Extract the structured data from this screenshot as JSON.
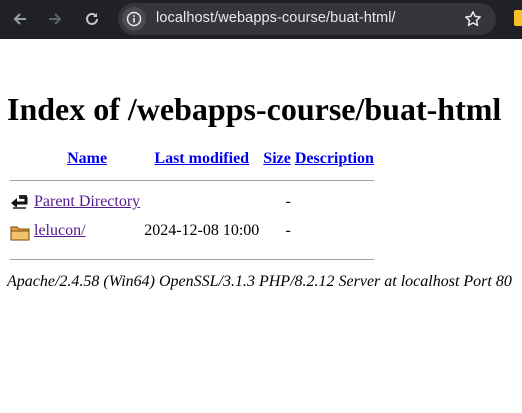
{
  "browser": {
    "url": "localhost/webapps-course/buat-html/",
    "icons": {
      "back": "arrow-left-icon",
      "forward": "arrow-right-icon",
      "reload": "reload-icon",
      "site_info": "site-info-icon",
      "bookmark": "star-icon"
    },
    "colors": {
      "toolbar": "#202124",
      "omnibox": "#35363a",
      "url_text": "#e8eaed"
    }
  },
  "page": {
    "title": "Index of /webapps-course/buat-html",
    "columns": {
      "name": "Name",
      "last_modified": "Last modified",
      "size": "Size",
      "description": "Description"
    },
    "rows": [
      {
        "icon": "back-folder-icon",
        "name": "Parent Directory",
        "last_modified": "",
        "size": "-",
        "description": ""
      },
      {
        "icon": "folder-icon",
        "name": "lelucon/",
        "last_modified": "2024-12-08 10:00",
        "size": "-",
        "description": ""
      }
    ],
    "server_signature": "Apache/2.4.58 (Win64) OpenSSL/3.1.3 PHP/8.2.12 Server at localhost Port 80",
    "colors": {
      "link": "#0000ee",
      "visited_link": "#551a8b"
    }
  }
}
